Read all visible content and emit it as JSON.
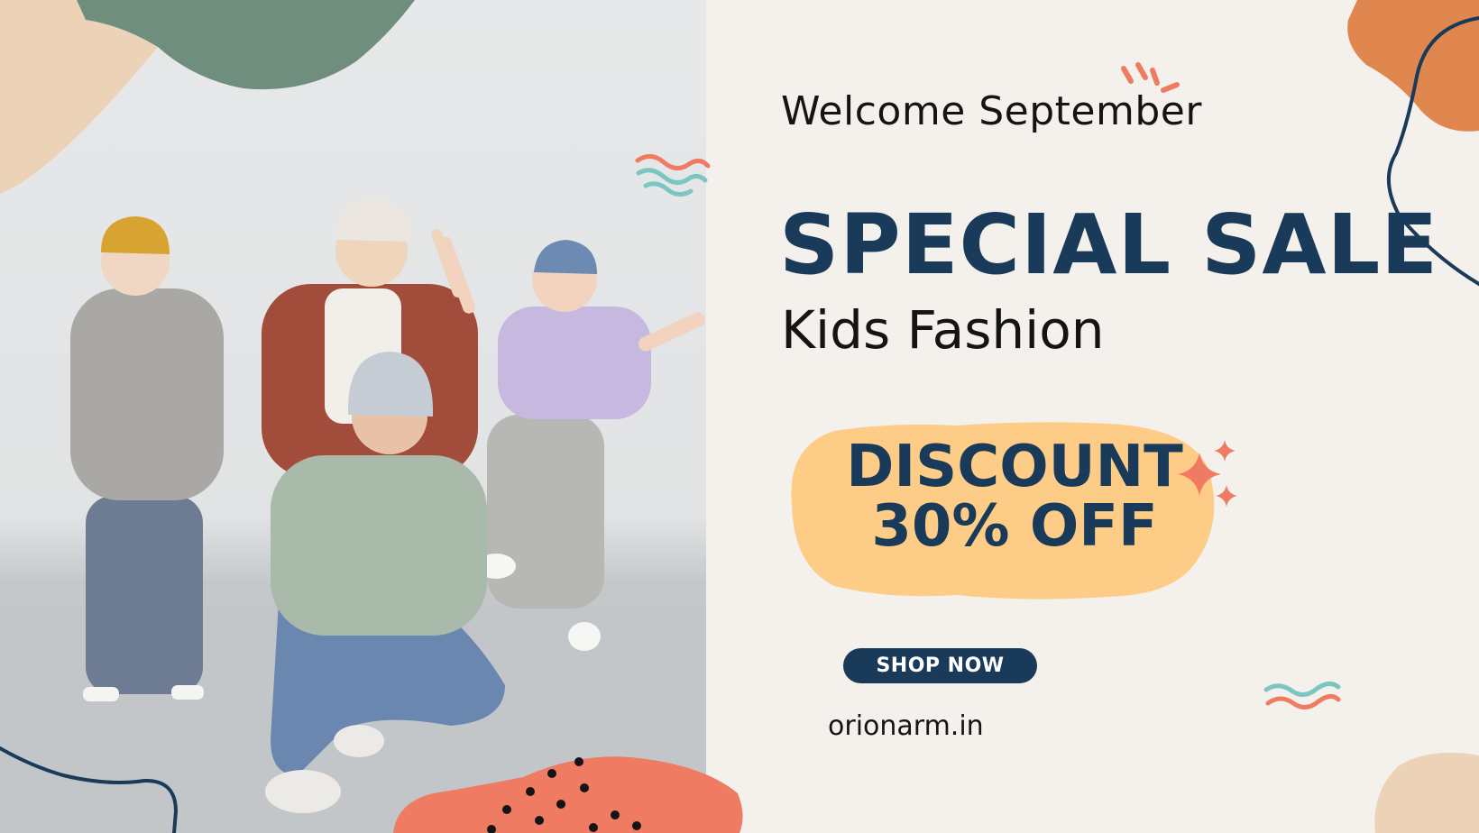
{
  "banner": {
    "welcome": "Welcome September",
    "title": "SPECIAL SALE",
    "subtitle": "Kids Fashion",
    "discount_line1": "DISCOUNT",
    "discount_line2": "30% OFF",
    "cta_label": "SHOP NOW",
    "website": "orionarm.in"
  },
  "colors": {
    "background": "#f4f1ec",
    "navy": "#193a59",
    "discount_blob": "#fdcd87",
    "coral": "#ee7b62",
    "sage": "#6f8e7e",
    "sand": "#ecd3b8",
    "orange": "#e0874f",
    "teal_squiggle": "#7cc6c2"
  },
  "photo": {
    "subject": "four children in casual fashion posing in a studio"
  }
}
